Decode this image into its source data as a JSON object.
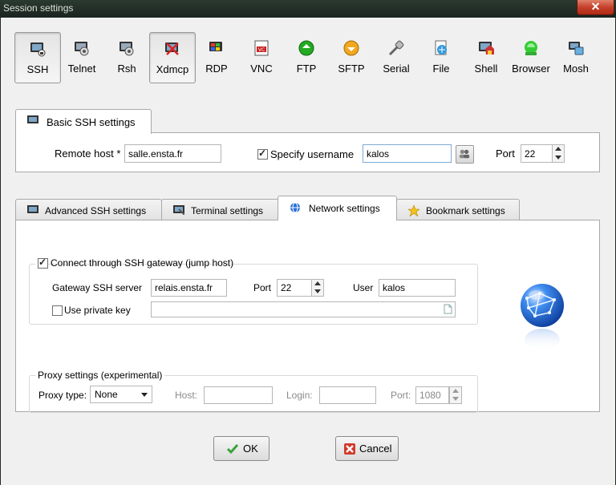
{
  "window": {
    "title": "Session settings",
    "close_glyph": "✕"
  },
  "protocols": [
    {
      "label": "SSH",
      "icon": "ssh-icon",
      "selected": true
    },
    {
      "label": "Telnet",
      "icon": "telnet-icon"
    },
    {
      "label": "Rsh",
      "icon": "rsh-icon"
    },
    {
      "label": "Xdmcp",
      "icon": "xdmcp-icon",
      "selected": true
    },
    {
      "label": "RDP",
      "icon": "rdp-icon"
    },
    {
      "label": "VNC",
      "icon": "vnc-icon"
    },
    {
      "label": "FTP",
      "icon": "ftp-icon"
    },
    {
      "label": "SFTP",
      "icon": "sftp-icon"
    },
    {
      "label": "Serial",
      "icon": "serial-icon"
    },
    {
      "label": "File",
      "icon": "file-icon"
    },
    {
      "label": "Shell",
      "icon": "shell-icon"
    },
    {
      "label": "Browser",
      "icon": "browser-icon"
    },
    {
      "label": "Mosh",
      "icon": "mosh-icon"
    }
  ],
  "basic": {
    "tab_label": "Basic SSH settings",
    "remote_host_label": "Remote host *",
    "remote_host_value": "salle.ensta.fr",
    "specify_username_label": "Specify username",
    "specify_username_checked": true,
    "username_value": "kalos",
    "port_label": "Port",
    "port_value": "22"
  },
  "tabs": [
    {
      "label": "Advanced SSH settings",
      "icon": "terminal-icon"
    },
    {
      "label": "Terminal settings",
      "icon": "terminal-settings-icon"
    },
    {
      "label": "Network settings",
      "icon": "globe-icon",
      "active": true
    },
    {
      "label": "Bookmark settings",
      "icon": "star-icon"
    }
  ],
  "network": {
    "gateway_checkbox_label": "Connect through SSH gateway (jump host)",
    "gateway_checked": true,
    "gateway_server_label": "Gateway SSH server",
    "gateway_server_value": "relais.ensta.fr",
    "port_label": "Port",
    "port_value": "22",
    "user_label": "User",
    "user_value": "kalos",
    "private_key_label": "Use private key",
    "private_key_checked": false,
    "private_key_value": "",
    "proxy_group_label": "Proxy settings (experimental)",
    "proxy_type_label": "Proxy type:",
    "proxy_type_value": "None",
    "host_label": "Host:",
    "host_value": "",
    "login_label": "Login:",
    "login_value": "",
    "proxy_port_label": "Port:",
    "proxy_port_value": "1080"
  },
  "buttons": {
    "ok_label": "OK",
    "cancel_label": "Cancel"
  },
  "colors": {
    "accent_blue": "#2a6fd6",
    "ok_green": "#3aa23a",
    "cancel_red": "#d23a2a"
  }
}
